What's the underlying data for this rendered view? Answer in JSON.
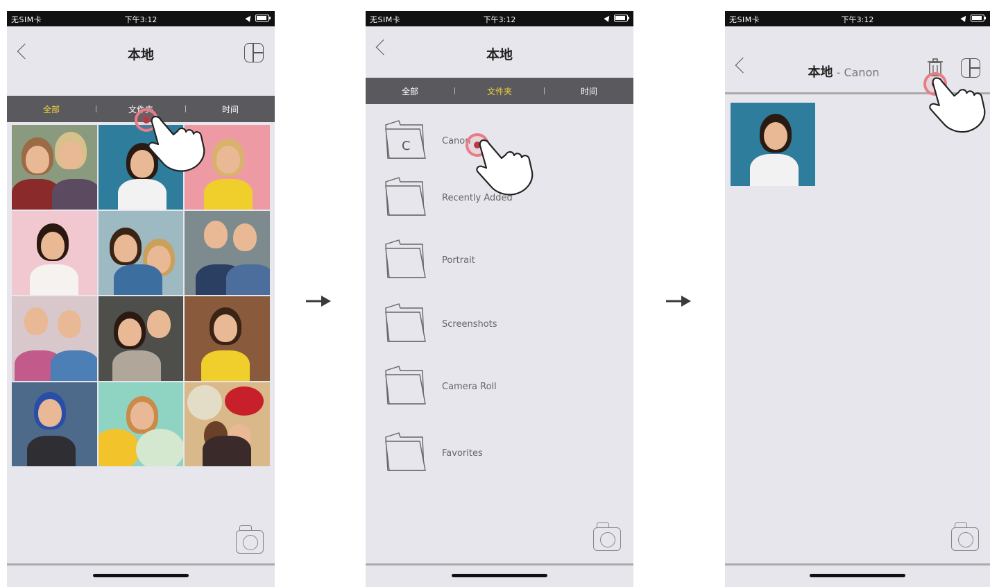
{
  "status_bar": {
    "carrier": "无SIM卡",
    "time": "下午3:12"
  },
  "screen1": {
    "title": "本地",
    "tabs": [
      {
        "label": "全部",
        "active": true
      },
      {
        "label": "文件夹",
        "active": false
      },
      {
        "label": "时间",
        "active": false
      }
    ]
  },
  "screen2": {
    "title": "本地",
    "tabs": [
      {
        "label": "全部",
        "active": false
      },
      {
        "label": "文件夹",
        "active": true
      },
      {
        "label": "时间",
        "active": false
      }
    ],
    "folders": [
      {
        "name": "Canon",
        "letter": "C"
      },
      {
        "name": "Recently Added",
        "letter": ""
      },
      {
        "name": "Portrait",
        "letter": ""
      },
      {
        "name": "Screenshots",
        "letter": ""
      },
      {
        "name": "Camera Roll",
        "letter": ""
      },
      {
        "name": "Favorites",
        "letter": ""
      }
    ]
  },
  "screen3": {
    "title_main": "本地",
    "title_sub": " - Canon"
  },
  "colors": {
    "accent_tab": "#f2d33a",
    "tab_bar": "#5a5a5e",
    "background": "#e6e6ec",
    "tap_ring": "#e87d86"
  },
  "icons": [
    "back-chevron-icon",
    "layout-icon",
    "camera-icon",
    "trash-icon",
    "folder-icon",
    "hand-pointer-icon",
    "arrow-right-icon"
  ]
}
